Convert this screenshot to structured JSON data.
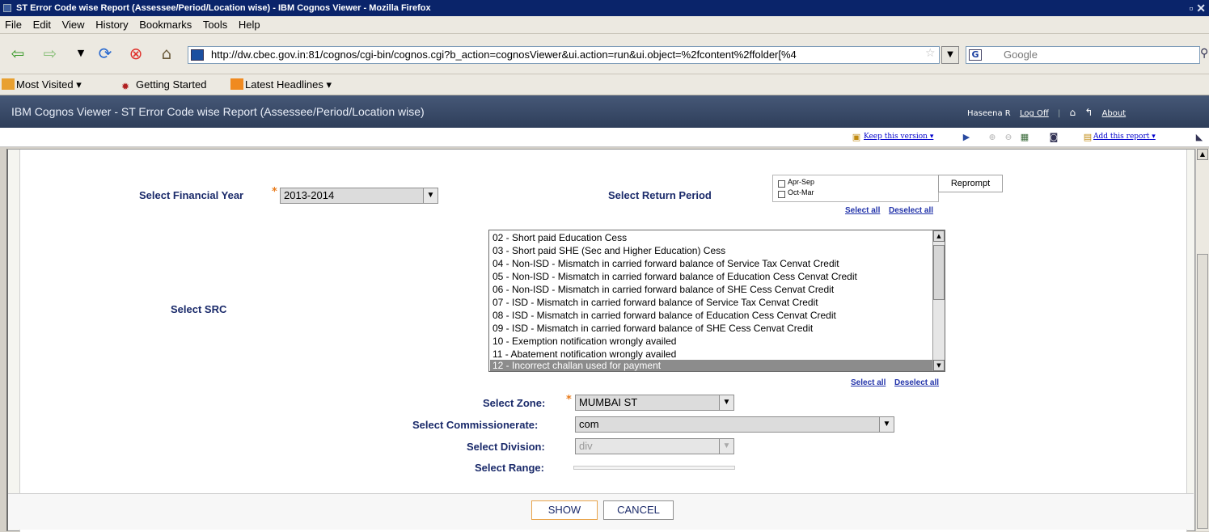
{
  "window": {
    "title": "ST Error Code wise Report (Assessee/Period/Location wise) - IBM Cognos Viewer - Mozilla Firefox"
  },
  "menubar": {
    "items": [
      "File",
      "Edit",
      "View",
      "History",
      "Bookmarks",
      "Tools",
      "Help"
    ]
  },
  "navbar": {
    "url": "http://dw.cbec.gov.in:81/cognos/cgi-bin/cognos.cgi?b_action=cognosViewer&ui.action=run&ui.object=%2fcontent%2ffolder[%4",
    "search_placeholder": "Google"
  },
  "bookmarks": {
    "most_visited": "Most Visited",
    "getting_started": "Getting Started",
    "latest_headlines": "Latest Headlines"
  },
  "cognos": {
    "header_title": "IBM Cognos Viewer - ST Error Code wise Report (Assessee/Period/Location wise)",
    "user": "Haseena R",
    "log_off": "Log Off",
    "about": "About",
    "keep_version": "Keep this version",
    "add_report": "Add this report"
  },
  "form": {
    "fy_label": "Select Financial Year",
    "fy_value": "2013-2014",
    "period_label": "Select Return Period",
    "period_options": [
      "Apr-Sep",
      "Oct-Mar"
    ],
    "reprompt": "Reprompt",
    "select_all": "Select all",
    "deselect_all": "Deselect all",
    "src_label": "Select SRC",
    "src_items": [
      "02 - Short paid Education Cess",
      "03 - Short paid SHE (Sec and Higher Education) Cess",
      "04 - Non-ISD - Mismatch in carried forward balance of Service Tax Cenvat Credit",
      "05 - Non-ISD - Mismatch in carried forward balance of Education Cess Cenvat Credit",
      "06 - Non-ISD - Mismatch in carried forward balance of SHE Cess Cenvat Credit",
      "07 - ISD - Mismatch in carried forward balance of Service Tax Cenvat Credit",
      "08 - ISD - Mismatch in carried forward balance of Education Cess Cenvat Credit",
      "09 - ISD - Mismatch in carried forward balance of SHE Cess Cenvat Credit",
      "10 - Exemption notification wrongly availed",
      "11 - Abatement notification wrongly availed",
      "12 - Incorrect challan used for payment"
    ],
    "zone_label": "Select Zone:",
    "zone_value": "MUMBAI ST",
    "commissionerate_label": "Select Commissionerate:",
    "commissionerate_value": "com",
    "division_label": "Select Division:",
    "division_value": "div",
    "range_label": "Select Range:",
    "show": "SHOW",
    "cancel": "CANCEL"
  },
  "colors": {
    "accent": "#1a2a6a",
    "required": "#e87a1a",
    "header": "#3a4a6a",
    "highlight": "#8c8c8c"
  }
}
